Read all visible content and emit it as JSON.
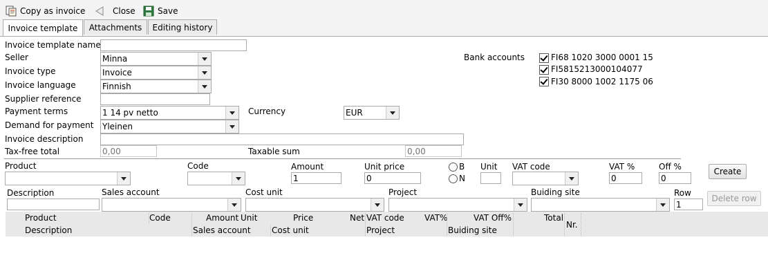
{
  "toolbar": {
    "copy_label": "Copy as invoice",
    "close_label": "Close",
    "save_label": "Save"
  },
  "tabs": [
    {
      "label": "Invoice template",
      "active": true
    },
    {
      "label": "Attachments",
      "active": false
    },
    {
      "label": "Editing history",
      "active": false
    }
  ],
  "form": {
    "template_name_label": "Invoice template name",
    "template_name_value": "",
    "seller_label": "Seller",
    "seller_value": "Minna",
    "invoice_type_label": "Invoice type",
    "invoice_type_value": "Invoice",
    "invoice_language_label": "Invoice language",
    "invoice_language_value": "Finnish",
    "supplier_reference_label": "Supplier reference",
    "supplier_reference_value": "",
    "payment_terms_label": "Payment terms",
    "payment_terms_value": "1 14 pv netto",
    "currency_label": "Currency",
    "currency_value": "EUR",
    "demand_label": "Demand for payment",
    "demand_value": "Yleinen",
    "description_label": "Invoice description",
    "description_value": "",
    "taxfree_label": "Tax-free total",
    "taxfree_placeholder": "0,00",
    "taxable_label": "Taxable sum",
    "taxable_placeholder": "0,00"
  },
  "bank": {
    "label": "Bank accounts",
    "accounts": [
      {
        "number": "FI68 1020 3000 0001 15",
        "checked": true
      },
      {
        "number": "FI5815213000104077",
        "checked": true
      },
      {
        "number": "FI30 8000 1002 1175 06",
        "checked": true
      }
    ]
  },
  "row_editor": {
    "product_label": "Product",
    "code_label": "Code",
    "amount_label": "Amount",
    "amount_value": "1",
    "unit_price_label": "Unit price",
    "unit_price_value": "0",
    "radio_b": "B",
    "radio_n": "N",
    "unit_label": "Unit",
    "vat_code_label": "VAT code",
    "vat_pct_label": "VAT %",
    "vat_pct_value": "0",
    "off_pct_label": "Off %",
    "off_pct_value": "0",
    "create_label": "Create",
    "description_label": "Description",
    "sales_account_label": "Sales account",
    "cost_unit_label": "Cost unit",
    "project_label": "Project",
    "building_site_label": "Buiding site",
    "row_label": "Row",
    "row_value": "1",
    "delete_row_label": "Delete row"
  },
  "grid": {
    "header_row1": [
      "Product",
      "Code",
      "Amount",
      "Unit",
      "Price",
      "Net",
      "VAT code",
      "VAT%",
      "VAT Off%",
      "Total"
    ],
    "header_row2": [
      "Description",
      "Sales account",
      "Cost unit",
      "Project",
      "Buiding site"
    ],
    "nr_label": "Nr."
  },
  "colors": {
    "toolbar_bg": "#f4f4f4",
    "grid_header_bg": "#e8e8e8",
    "save_icon": "#2f7a3e"
  }
}
